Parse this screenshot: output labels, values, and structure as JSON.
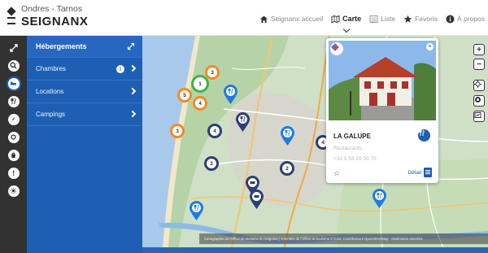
{
  "header": {
    "brand_sub": "Ondres - Tarnos",
    "brand_title": "SEIGNANX",
    "nav": [
      {
        "label": "Seignanx accueil",
        "icon": "home-icon"
      },
      {
        "label": "Carte",
        "icon": "map-icon",
        "active": true
      },
      {
        "label": "Liste",
        "icon": "list-icon"
      },
      {
        "label": "Favoris",
        "icon": "star-icon"
      },
      {
        "label": "À propos",
        "icon": "info-icon"
      }
    ]
  },
  "rail": {
    "icons": [
      "collapse-icon",
      "search-icon",
      "bed-icon",
      "restaurant-icon",
      "compass-icon",
      "leisure-icon",
      "shopping-icon",
      "event-icon",
      "service-icon"
    ]
  },
  "panel": {
    "title": "Hébergements",
    "items": [
      {
        "label": "Chambres",
        "has_info": true
      },
      {
        "label": "Locations"
      },
      {
        "label": "Campings"
      }
    ],
    "info_glyph": "i"
  },
  "map": {
    "credits": "Cartographie de l'Office de tourisme du Seignanx | Données de l'Office de tourisme © Cont. Contributeurs OpenStreetMap - Modération données",
    "controls": [
      "zoom-in",
      "zoom-out",
      "locate",
      "layers",
      "fullscreen"
    ],
    "zoom_in_glyph": "+",
    "zoom_out_glyph": "−",
    "clusters": [
      {
        "label": "3",
        "color": "orange"
      },
      {
        "label": "5",
        "color": "orange"
      },
      {
        "label": "1",
        "color": "green"
      },
      {
        "label": "4",
        "color": "orange"
      },
      {
        "label": "3",
        "color": "orange"
      },
      {
        "label": "4",
        "color": "navy"
      },
      {
        "label": "2",
        "color": "navy"
      },
      {
        "label": "2",
        "color": "navy"
      },
      {
        "label": "4",
        "color": "navy"
      }
    ]
  },
  "popup": {
    "name": "LA GALUPE",
    "category": "Restaurants",
    "phone": "+33 5 59 20 00 70",
    "detail_label": "Détail",
    "close_glyph": "×",
    "star_glyph": "☆"
  },
  "colors": {
    "panel": "#1e5fb4",
    "rail": "#323232",
    "pin_blue": "#1e7be0",
    "pin_navy": "#2c3f73"
  }
}
